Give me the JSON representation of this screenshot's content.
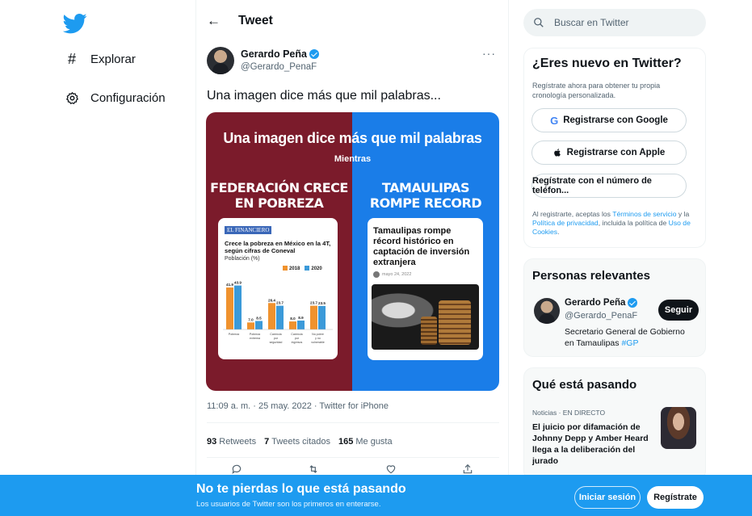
{
  "nav": {
    "items": [
      {
        "label": "Explorar",
        "icon": "hashtag-icon"
      },
      {
        "label": "Configuración",
        "icon": "gear-icon"
      }
    ]
  },
  "header": {
    "title": "Tweet"
  },
  "tweet": {
    "author_name": "Gerardo Peña",
    "author_handle": "@Gerardo_PenaF",
    "text": "Una imagen dice más que mil palabras...",
    "image": {
      "title": "Una imagen dice más que mil palabras",
      "subtitle": "Mientras",
      "left_heading_1": "FEDERACIÓN CRECE",
      "left_heading_2": "EN POBREZA",
      "right_heading_1": "TAMAULIPAS",
      "right_heading_2": "ROMPE RECORD",
      "left_card": {
        "publisher": "EL FINANCIERO",
        "headline": "Crece la pobreza en México en la 4T, según cifras de Coneval",
        "unit": "Población (%)",
        "legend": [
          "2018",
          "2020"
        ],
        "colors": {
          "2018": "#f0922e",
          "2020": "#3b9ad9"
        }
      },
      "right_card": {
        "headline": "Tamaulipas rompe récord histórico en captación de inversión extranjera",
        "byline": "mayo 24, 2022"
      }
    },
    "meta": "11:09 a. m. · 25 may. 2022 · Twitter for iPhone",
    "retweets": "93",
    "retweets_label": "Retweets",
    "quotes": "7",
    "quotes_label": "Tweets citados",
    "likes": "165",
    "likes_label": "Me gusta"
  },
  "chart_data": {
    "type": "bar",
    "title": "Crece la pobreza en México en la 4T, según cifras de Coneval",
    "ylabel": "Población (%)",
    "categories": [
      "Pobreza",
      "Pobreza extrema",
      "Carencia por seguridad social",
      "Carencia por ingresos",
      "No pobre y no vulnerable"
    ],
    "series": [
      {
        "name": "2018",
        "values": [
          41.9,
          7.0,
          26.4,
          8.0,
          23.7
        ]
      },
      {
        "name": "2020",
        "values": [
          43.9,
          8.5,
          23.7,
          8.9,
          23.5
        ]
      }
    ],
    "ylim": [
      0,
      50
    ]
  },
  "sidebar": {
    "search_placeholder": "Buscar en Twitter",
    "new": {
      "title": "¿Eres nuevo en Twitter?",
      "desc": "Regístrate ahora para obtener tu propia cronología personalizada.",
      "google": "Registrarse con Google",
      "apple": "Registrarse con Apple",
      "phone": "Regístrate con el número de teléfon...",
      "legal_1": "Al registrarte, aceptas los ",
      "legal_terms": "Términos de servicio",
      "legal_2": " y la ",
      "legal_privacy": "Política de privacidad",
      "legal_3": ", incluida la política de ",
      "legal_cookies": "Uso de Cookies",
      "legal_4": "."
    },
    "relevant": {
      "title": "Personas relevantes",
      "name": "Gerardo Peña",
      "handle": "@Gerardo_PenaF",
      "bio": "Secretario General de Gobierno en Tamaulipas ",
      "bio_tag": "#GP",
      "follow": "Seguir"
    },
    "trending": {
      "title": "Qué está pasando",
      "category": "Noticias · EN DIRECTO",
      "headline": "El juicio por difamación de Johnny Depp y Amber Heard llega a la deliberación del jurado"
    }
  },
  "banner": {
    "title": "No te pierdas lo que está pasando",
    "subtitle": "Los usuarios de Twitter son los primeros en enterarse.",
    "login": "Iniciar sesión",
    "signup": "Regístrate"
  }
}
